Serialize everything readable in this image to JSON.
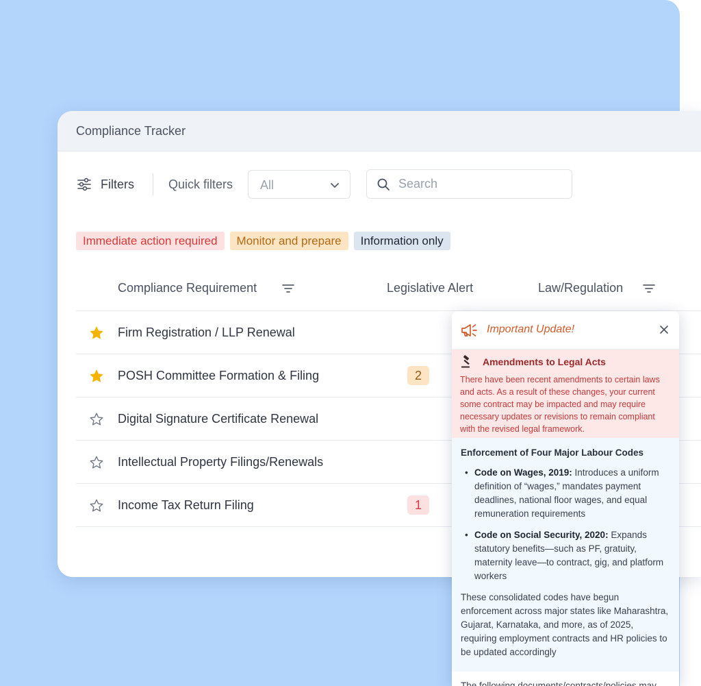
{
  "window": {
    "title": "Compliance Tracker"
  },
  "toolbar": {
    "filters_label": "Filters",
    "quick_filters_label": "Quick filters",
    "quick_filter_value": "All",
    "search_placeholder": "Search"
  },
  "legend": {
    "immediate": "Immediate action required",
    "monitor": "Monitor and prepare",
    "info": "Information only"
  },
  "table": {
    "columns": {
      "requirement": "Compliance Requirement",
      "alert": "Legislative Alert",
      "law": "Law/Regulation"
    },
    "rows": [
      {
        "label": "Firm Registration / LLP Renewal",
        "starred": true,
        "alert": ""
      },
      {
        "label": "POSH Committee Formation & Filing",
        "starred": true,
        "alert": "2"
      },
      {
        "label": "Digital Signature Certificate Renewal",
        "starred": false,
        "alert": ""
      },
      {
        "label": "Intellectual Property Filings/Renewals",
        "starred": false,
        "alert": ""
      },
      {
        "label": "Income Tax Return Filing",
        "starred": false,
        "alert": "1"
      }
    ]
  },
  "popup": {
    "title": "Important Update!",
    "alert_title": "Amendments to Legal Acts",
    "alert_text": "There have been recent amendments to certain laws and acts.  As a result of these changes, your current some contract may be impacted and may require necessary updates or revisions to remain compliant with the revised legal framework.",
    "heading": "Enforcement of Four Major Labour Codes",
    "bullets": [
      {
        "bold": "Code on Wages, 2019:",
        "text": " Introduces a uniform definition of “wages,” mandates payment deadlines, national floor wages, and equal remuneration requirements"
      },
      {
        "bold": "Code on Social Security, 2020:",
        "text": " Expands statutory benefits—such as PF, gratuity, maternity leave—to contract, gig, and platform workers"
      }
    ],
    "paragraph": "These consolidated codes have begun enforcement across major states like Maharashtra, Gujarat, Karnataka, and more, as of 2025, requiring employment contracts and HR policies to be updated accordingly",
    "footer_text": "The following documents/contracts/policies may"
  },
  "colors": {
    "backdrop": "#b3d5fc",
    "star_filled": "#f5b400",
    "star_outline": "#6f7683",
    "alert_red": "#d83a3a",
    "accent_orange": "#d25b2a"
  },
  "icons": {
    "filters": "sliders-icon",
    "dropdown": "chevron-down-icon",
    "search": "search-icon",
    "sort": "filter-lines-icon",
    "star": "star-icon",
    "megaphone": "megaphone-icon",
    "close": "close-icon",
    "gavel": "gavel-icon"
  }
}
